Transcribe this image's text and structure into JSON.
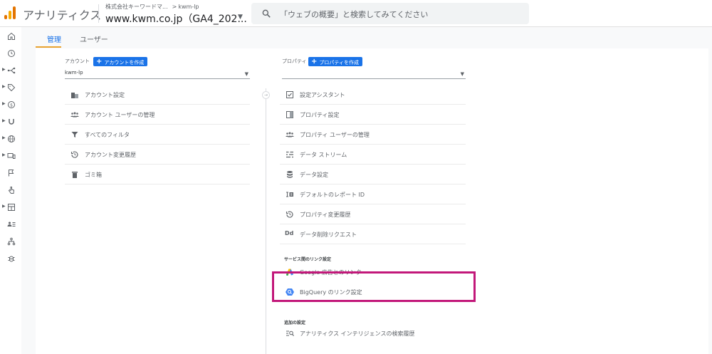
{
  "header": {
    "app_title": "アナリティクス",
    "account_crumb": "株式会社キーワードマ...",
    "crumb_arrow": ">",
    "property_crumb": "kwm-lp",
    "property_name": "www.kwm.co.jp（GA4_202...",
    "search_placeholder": "「ウェブの概要」と検索してみてください"
  },
  "tabs": [
    {
      "label": "管理"
    },
    {
      "label": "ユーザー"
    }
  ],
  "account": {
    "heading": "アカウント",
    "create_label": "アカウントを作成",
    "selected": "kwm-lp",
    "items": [
      {
        "label": "アカウント設定",
        "icon": "building-icon"
      },
      {
        "label": "アカウント ユーザーの管理",
        "icon": "users-icon"
      },
      {
        "label": "すべてのフィルタ",
        "icon": "filter-icon"
      },
      {
        "label": "アカウント変更履歴",
        "icon": "history-icon"
      },
      {
        "label": "ゴミ箱",
        "icon": "trash-icon"
      }
    ]
  },
  "property": {
    "heading": "プロパティ",
    "create_label": "プロパティを作成",
    "selected": "",
    "items": [
      {
        "label": "設定アシスタント",
        "icon": "checklist-icon"
      },
      {
        "label": "プロパティ設定",
        "icon": "property-settings-icon"
      },
      {
        "label": "プロパティ ユーザーの管理",
        "icon": "users-icon"
      },
      {
        "label": "データ ストリーム",
        "icon": "stream-icon"
      },
      {
        "label": "データ設定",
        "icon": "database-icon"
      },
      {
        "label": "デフォルトのレポート ID",
        "icon": "report-id-icon"
      },
      {
        "label": "プロパティ変更履歴",
        "icon": "history-icon"
      },
      {
        "label": "データ削除リクエスト",
        "icon": "dd-icon",
        "icon_text": "Dd"
      }
    ],
    "service_links_heading": "サービス間のリンク設定",
    "service_links": [
      {
        "label": "Google 広告とのリンク",
        "icon": "google-ads-icon"
      },
      {
        "label": "BigQuery のリンク設定",
        "icon": "bigquery-icon"
      }
    ],
    "additional_heading": "追加の設定",
    "additional": [
      {
        "label": "アナリティクス インテリジェンスの検索履歴",
        "icon": "search-history-icon"
      }
    ]
  },
  "colors": {
    "accent": "#1a73e8",
    "tab_underline": "#e8a331",
    "highlight_box": "#c2187a"
  }
}
